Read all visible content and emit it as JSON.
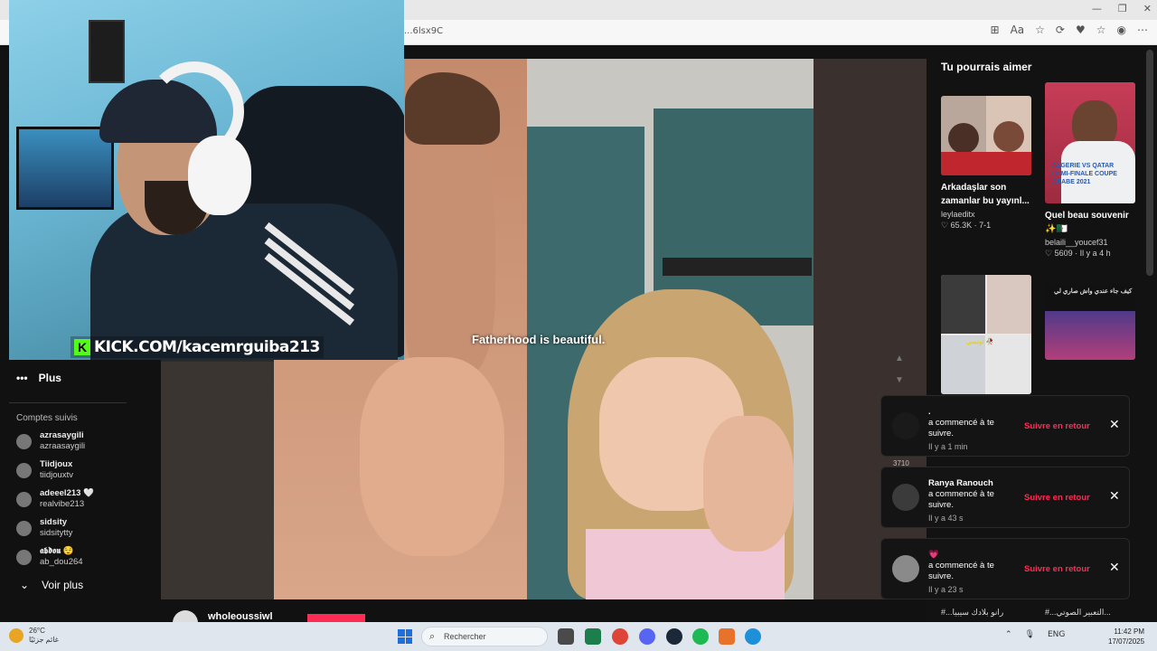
{
  "browser": {
    "url": "...6lsx9C",
    "window_controls": [
      "—",
      "❐",
      "✕"
    ],
    "toolbar_icons": [
      "⊞",
      "Aa",
      "☆",
      "⟳",
      "♥",
      "☆",
      "◉",
      "⋯"
    ]
  },
  "webcam": {
    "kick_logo": "K",
    "kick_text": "KICK.COM/kacemrguiba213"
  },
  "sidebar": {
    "more_label": "Plus",
    "followed_title": "Comptes suivis",
    "followed": [
      {
        "name": "azrasaygili",
        "handle": "azraasaygili"
      },
      {
        "name": "Tiidjoux",
        "handle": "tiidjouxtv"
      },
      {
        "name": "adeeel213 🤍",
        "handle": "realvibe213"
      },
      {
        "name": "sidsity",
        "handle": "sidsitytty"
      },
      {
        "name": "𝖆𝖇𝖉𝖔𝖚 😌",
        "handle": "ab_dou264"
      }
    ],
    "see_more": "Voir plus"
  },
  "video": {
    "subtitle": "Fatherhood is beautiful.",
    "side_count": "3710",
    "creator": "wholeoussiwl"
  },
  "recommendations": {
    "title": "Tu pourrais aimer",
    "items": [
      {
        "title": "Arkadaşlar son zamanlar bu yayınl...",
        "author": "leylaeditx",
        "stats": "♡ 65.3K · 7-1",
        "thumb_text": ""
      },
      {
        "title": "Quel beau souvenir ✨🇩🇿",
        "author": "belaili__youcef31",
        "stats": "♡ 5609 · Il y a 4 h",
        "thumb_text": "ALGERIE VS QATAR DEMI-FINALE COUPE ARABE 2021"
      },
      {
        "title": "",
        "author": "",
        "stats": "",
        "thumb_text": "تونسي 🥀"
      },
      {
        "title": "",
        "author": "",
        "stats": "",
        "thumb_text": "كيف جاء عندي واش صاري لي"
      }
    ],
    "bottom_captions": [
      "#...رانو بلادك سيبيا",
      "#...التعبير الصوتي..."
    ]
  },
  "notifications": [
    {
      "who": ".",
      "text": "a commencé à te suivre.",
      "time": "Il y a 1 min",
      "action": "Suivre en retour",
      "close": "✕"
    },
    {
      "who": "Ranya Ranouch",
      "text": "a commencé à te suivre.",
      "time": "Il y a 43 s",
      "action": "Suivre en retour",
      "close": "✕"
    },
    {
      "who": "💗",
      "text": "a commencé à te suivre.",
      "time": "Il y a 23 s",
      "action": "Suivre en retour",
      "close": "✕"
    }
  ],
  "taskbar": {
    "weather_temp": "26°C",
    "weather_desc": "غائم جزئيًا",
    "search_placeholder": "Rechercher",
    "lang": "ENG",
    "time": "11:42 PM",
    "date": "17/07/2025"
  },
  "colors": {
    "accent": "#fe2c55",
    "kick_green": "#53fc18",
    "page_bg": "#121212"
  }
}
